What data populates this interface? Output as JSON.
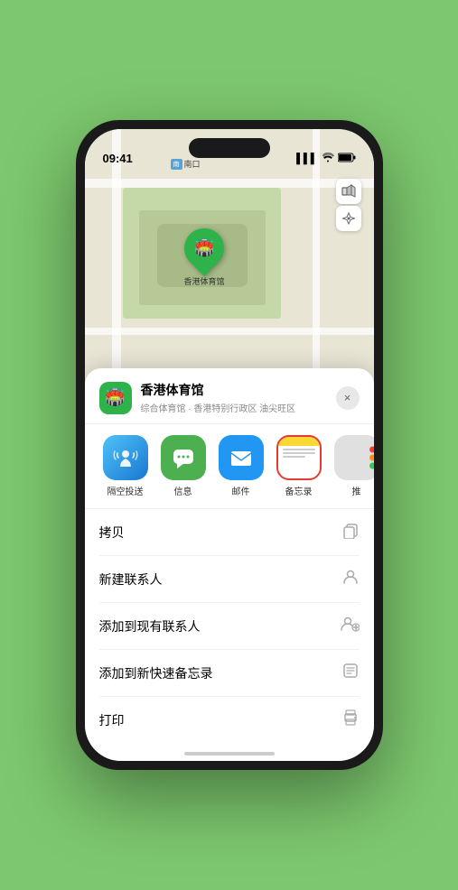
{
  "status": {
    "time": "09:41",
    "signal_bars": "▌▌▌",
    "wifi": "wifi",
    "battery": "battery"
  },
  "map": {
    "label_south_entrance": "南口",
    "stadium_name_marker": "香港体育馆"
  },
  "location_card": {
    "name": "香港体育馆",
    "description": "综合体育馆 · 香港特别行政区 油尖旺区",
    "close_label": "×"
  },
  "share_actions": [
    {
      "id": "airdrop",
      "label": "隔空投送",
      "type": "airdrop"
    },
    {
      "id": "messages",
      "label": "信息",
      "type": "messages"
    },
    {
      "id": "mail",
      "label": "邮件",
      "type": "mail"
    },
    {
      "id": "notes",
      "label": "备忘录",
      "type": "notes"
    },
    {
      "id": "more",
      "label": "推",
      "type": "more"
    }
  ],
  "action_items": [
    {
      "id": "copy",
      "label": "拷贝",
      "icon": "copy"
    },
    {
      "id": "new_contact",
      "label": "新建联系人",
      "icon": "person"
    },
    {
      "id": "add_existing",
      "label": "添加到现有联系人",
      "icon": "person_add"
    },
    {
      "id": "add_notes",
      "label": "添加到新快速备忘录",
      "icon": "notes_quick"
    },
    {
      "id": "print",
      "label": "打印",
      "icon": "print"
    }
  ],
  "colors": {
    "green": "#2db34a",
    "airdrop_gradient_start": "#4fc3f7",
    "airdrop_gradient_end": "#1976d2",
    "messages_green": "#4caf50",
    "mail_blue": "#2196F3",
    "notes_yellow": "#fdd835",
    "notes_border": "#e53935"
  }
}
